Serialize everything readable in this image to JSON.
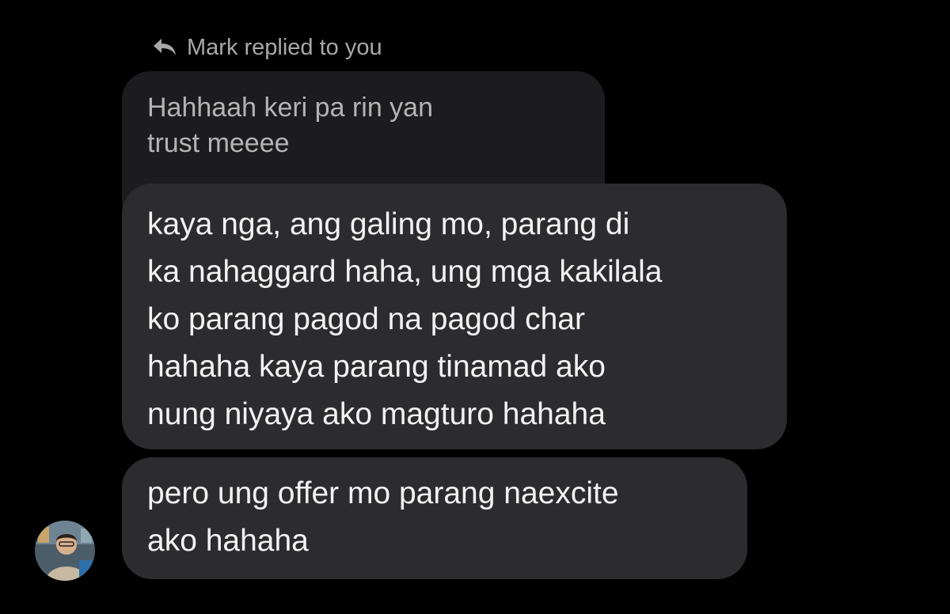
{
  "reply_header": {
    "text": "Mark replied to you",
    "icon": "reply-arrow-icon"
  },
  "quoted_message": {
    "text": "Hahhaah keri pa rin yan\ntrust meeee"
  },
  "messages": [
    {
      "text": "kaya nga, ang galing mo,  parang di\nka nahaggard haha, ung mga kakilala\nko parang pagod na pagod char\nhahaha kaya  parang tinamad ako\nnung niyaya ako magturo hahaha"
    },
    {
      "text": "pero ung offer mo parang naexcite\nako hahaha"
    }
  ],
  "avatar": {
    "icon": "user-avatar"
  },
  "colors": {
    "background": "#000000",
    "quoted_bubble": "#1c1c1e",
    "message_bubble": "#2c2c2e",
    "secondary_text": "#a8a8a8",
    "primary_text": "#f2f2f2"
  }
}
